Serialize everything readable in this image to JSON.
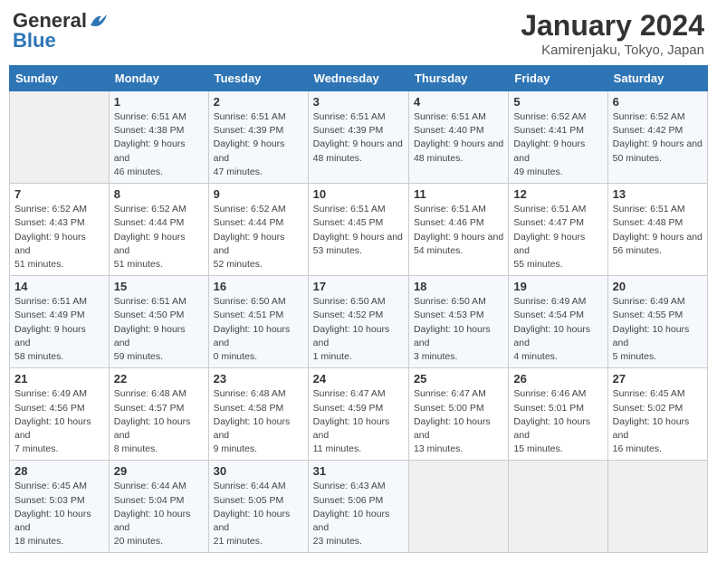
{
  "header": {
    "logo_general": "General",
    "logo_blue": "Blue",
    "title": "January 2024",
    "subtitle": "Kamirenjaku, Tokyo, Japan"
  },
  "weekdays": [
    "Sunday",
    "Monday",
    "Tuesday",
    "Wednesday",
    "Thursday",
    "Friday",
    "Saturday"
  ],
  "weeks": [
    [
      {
        "day": "",
        "sunrise": "",
        "sunset": "",
        "daylight": "",
        "empty": true
      },
      {
        "day": "1",
        "sunrise": "Sunrise: 6:51 AM",
        "sunset": "Sunset: 4:38 PM",
        "daylight": "Daylight: 9 hours and 46 minutes."
      },
      {
        "day": "2",
        "sunrise": "Sunrise: 6:51 AM",
        "sunset": "Sunset: 4:39 PM",
        "daylight": "Daylight: 9 hours and 47 minutes."
      },
      {
        "day": "3",
        "sunrise": "Sunrise: 6:51 AM",
        "sunset": "Sunset: 4:39 PM",
        "daylight": "Daylight: 9 hours and 48 minutes."
      },
      {
        "day": "4",
        "sunrise": "Sunrise: 6:51 AM",
        "sunset": "Sunset: 4:40 PM",
        "daylight": "Daylight: 9 hours and 48 minutes."
      },
      {
        "day": "5",
        "sunrise": "Sunrise: 6:52 AM",
        "sunset": "Sunset: 4:41 PM",
        "daylight": "Daylight: 9 hours and 49 minutes."
      },
      {
        "day": "6",
        "sunrise": "Sunrise: 6:52 AM",
        "sunset": "Sunset: 4:42 PM",
        "daylight": "Daylight: 9 hours and 50 minutes."
      }
    ],
    [
      {
        "day": "7",
        "sunrise": "Sunrise: 6:52 AM",
        "sunset": "Sunset: 4:43 PM",
        "daylight": "Daylight: 9 hours and 51 minutes."
      },
      {
        "day": "8",
        "sunrise": "Sunrise: 6:52 AM",
        "sunset": "Sunset: 4:44 PM",
        "daylight": "Daylight: 9 hours and 51 minutes."
      },
      {
        "day": "9",
        "sunrise": "Sunrise: 6:52 AM",
        "sunset": "Sunset: 4:44 PM",
        "daylight": "Daylight: 9 hours and 52 minutes."
      },
      {
        "day": "10",
        "sunrise": "Sunrise: 6:51 AM",
        "sunset": "Sunset: 4:45 PM",
        "daylight": "Daylight: 9 hours and 53 minutes."
      },
      {
        "day": "11",
        "sunrise": "Sunrise: 6:51 AM",
        "sunset": "Sunset: 4:46 PM",
        "daylight": "Daylight: 9 hours and 54 minutes."
      },
      {
        "day": "12",
        "sunrise": "Sunrise: 6:51 AM",
        "sunset": "Sunset: 4:47 PM",
        "daylight": "Daylight: 9 hours and 55 minutes."
      },
      {
        "day": "13",
        "sunrise": "Sunrise: 6:51 AM",
        "sunset": "Sunset: 4:48 PM",
        "daylight": "Daylight: 9 hours and 56 minutes."
      }
    ],
    [
      {
        "day": "14",
        "sunrise": "Sunrise: 6:51 AM",
        "sunset": "Sunset: 4:49 PM",
        "daylight": "Daylight: 9 hours and 58 minutes."
      },
      {
        "day": "15",
        "sunrise": "Sunrise: 6:51 AM",
        "sunset": "Sunset: 4:50 PM",
        "daylight": "Daylight: 9 hours and 59 minutes."
      },
      {
        "day": "16",
        "sunrise": "Sunrise: 6:50 AM",
        "sunset": "Sunset: 4:51 PM",
        "daylight": "Daylight: 10 hours and 0 minutes."
      },
      {
        "day": "17",
        "sunrise": "Sunrise: 6:50 AM",
        "sunset": "Sunset: 4:52 PM",
        "daylight": "Daylight: 10 hours and 1 minute."
      },
      {
        "day": "18",
        "sunrise": "Sunrise: 6:50 AM",
        "sunset": "Sunset: 4:53 PM",
        "daylight": "Daylight: 10 hours and 3 minutes."
      },
      {
        "day": "19",
        "sunrise": "Sunrise: 6:49 AM",
        "sunset": "Sunset: 4:54 PM",
        "daylight": "Daylight: 10 hours and 4 minutes."
      },
      {
        "day": "20",
        "sunrise": "Sunrise: 6:49 AM",
        "sunset": "Sunset: 4:55 PM",
        "daylight": "Daylight: 10 hours and 5 minutes."
      }
    ],
    [
      {
        "day": "21",
        "sunrise": "Sunrise: 6:49 AM",
        "sunset": "Sunset: 4:56 PM",
        "daylight": "Daylight: 10 hours and 7 minutes."
      },
      {
        "day": "22",
        "sunrise": "Sunrise: 6:48 AM",
        "sunset": "Sunset: 4:57 PM",
        "daylight": "Daylight: 10 hours and 8 minutes."
      },
      {
        "day": "23",
        "sunrise": "Sunrise: 6:48 AM",
        "sunset": "Sunset: 4:58 PM",
        "daylight": "Daylight: 10 hours and 9 minutes."
      },
      {
        "day": "24",
        "sunrise": "Sunrise: 6:47 AM",
        "sunset": "Sunset: 4:59 PM",
        "daylight": "Daylight: 10 hours and 11 minutes."
      },
      {
        "day": "25",
        "sunrise": "Sunrise: 6:47 AM",
        "sunset": "Sunset: 5:00 PM",
        "daylight": "Daylight: 10 hours and 13 minutes."
      },
      {
        "day": "26",
        "sunrise": "Sunrise: 6:46 AM",
        "sunset": "Sunset: 5:01 PM",
        "daylight": "Daylight: 10 hours and 15 minutes."
      },
      {
        "day": "27",
        "sunrise": "Sunrise: 6:45 AM",
        "sunset": "Sunset: 5:02 PM",
        "daylight": "Daylight: 10 hours and 16 minutes."
      }
    ],
    [
      {
        "day": "28",
        "sunrise": "Sunrise: 6:45 AM",
        "sunset": "Sunset: 5:03 PM",
        "daylight": "Daylight: 10 hours and 18 minutes."
      },
      {
        "day": "29",
        "sunrise": "Sunrise: 6:44 AM",
        "sunset": "Sunset: 5:04 PM",
        "daylight": "Daylight: 10 hours and 20 minutes."
      },
      {
        "day": "30",
        "sunrise": "Sunrise: 6:44 AM",
        "sunset": "Sunset: 5:05 PM",
        "daylight": "Daylight: 10 hours and 21 minutes."
      },
      {
        "day": "31",
        "sunrise": "Sunrise: 6:43 AM",
        "sunset": "Sunset: 5:06 PM",
        "daylight": "Daylight: 10 hours and 23 minutes."
      },
      {
        "day": "",
        "sunrise": "",
        "sunset": "",
        "daylight": "",
        "empty": true
      },
      {
        "day": "",
        "sunrise": "",
        "sunset": "",
        "daylight": "",
        "empty": true
      },
      {
        "day": "",
        "sunrise": "",
        "sunset": "",
        "daylight": "",
        "empty": true
      }
    ]
  ]
}
